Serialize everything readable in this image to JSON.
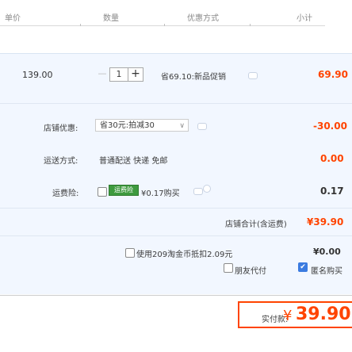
{
  "header": {
    "unit_price": "单价",
    "quantity": "数量",
    "promotion": "优惠方式",
    "subtotal": "小计"
  },
  "item": {
    "price": "139.00",
    "quantity": "1",
    "minus": "—",
    "plus": "+",
    "promotion": "省69.10:新品促销",
    "subtotal": "69.90"
  },
  "store_discount": {
    "label": "店铺优惠:",
    "selected": "省30元:拍减30",
    "value": "-30.00"
  },
  "shipping": {
    "label": "运送方式:",
    "value_text": "普通配送 快递 免邮",
    "value": "0.00"
  },
  "insurance": {
    "label": "运费险:",
    "badge": "运费险",
    "text": "¥0.17购买",
    "value": "0.17"
  },
  "store_total": {
    "label": "店铺合计(含运费)",
    "value": "¥39.90"
  },
  "points": {
    "text": "使用209淘金币抵扣2.09元",
    "value": "¥0.00"
  },
  "options": {
    "friend_pay": "朋友代付",
    "anonymous": "匿名购买",
    "anonymous_checked": true
  },
  "payment": {
    "label": "实付款:",
    "currency": "¥",
    "amount": "39.90"
  },
  "colors": {
    "accent": "#ff4400",
    "panel": "#f2f7ff",
    "badge": "#3e9a3e"
  }
}
